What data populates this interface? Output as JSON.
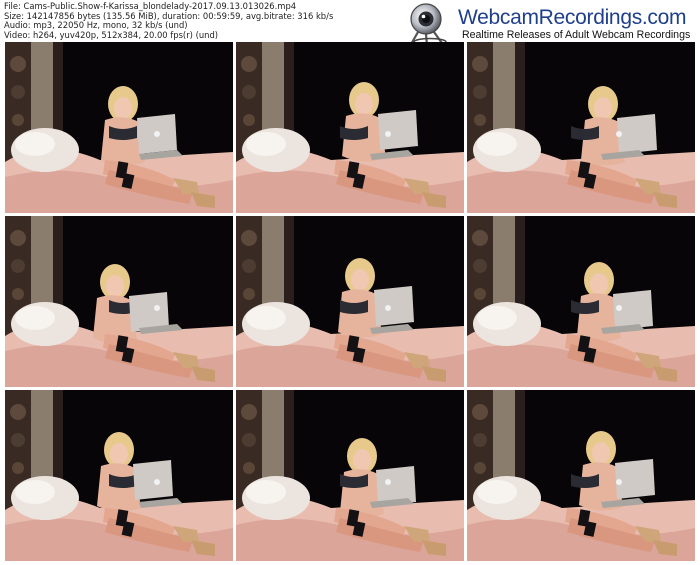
{
  "info": {
    "file": "File: Cams-Public.Show-f-Karissa_blondelady-2017.09.13.013026.mp4",
    "size": "Size: 142147856 bytes (135.56 MiB), duration: 00:59:59, avg.bitrate: 316 kb/s",
    "audio": "Audio: mp3, 22050 Hz, mono, 32 kb/s (und)",
    "video": "Video: h264, yuv420p, 512x384, 20.00 fps(r) (und)"
  },
  "logo": {
    "brand": "WebcamRecordings.com",
    "tagline": "Realtime Releases of Adult Webcam Recordings",
    "icon": "webcam-icon"
  },
  "thumbnails": [
    {
      "index": 1,
      "description": "video frame"
    },
    {
      "index": 2,
      "description": "video frame"
    },
    {
      "index": 3,
      "description": "video frame"
    },
    {
      "index": 4,
      "description": "video frame"
    },
    {
      "index": 5,
      "description": "video frame"
    },
    {
      "index": 6,
      "description": "video frame"
    },
    {
      "index": 7,
      "description": "video frame"
    },
    {
      "index": 8,
      "description": "video frame"
    },
    {
      "index": 9,
      "description": "video frame"
    }
  ]
}
